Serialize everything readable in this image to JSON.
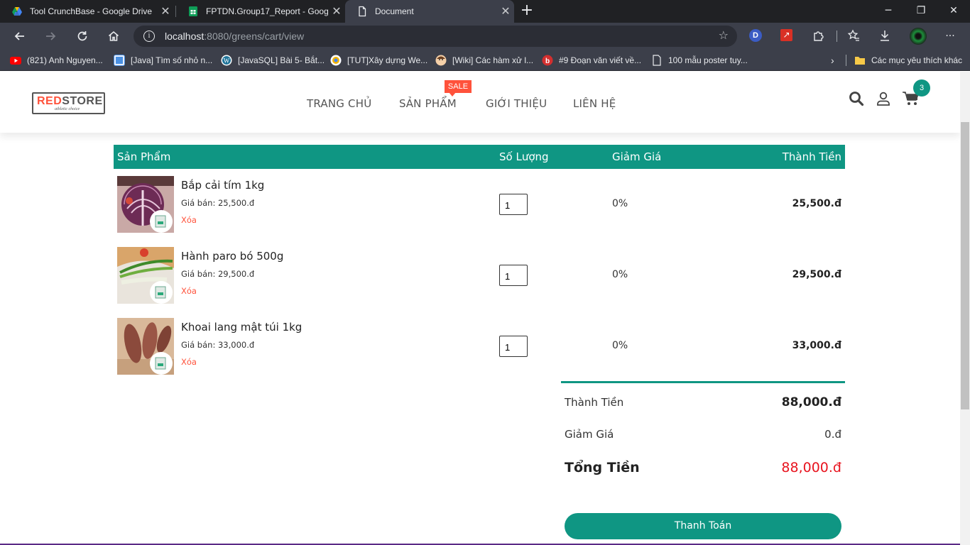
{
  "browser": {
    "tabs": [
      {
        "title": "Tool CrunchBase - Google Drive",
        "icon": "google-drive-icon"
      },
      {
        "title": "FPTDN.Group17_Report - Google",
        "icon": "google-sheets-icon"
      },
      {
        "title": "Document",
        "icon": "document-icon"
      }
    ],
    "url_host": "localhost",
    "url_path": ":8080/greens/cart/view",
    "profile_initial": "D",
    "bookmarks": [
      {
        "label": "(821) Anh Nguyen...",
        "icon": "youtube-icon",
        "color": "#ff0000"
      },
      {
        "label": "[Java] Tìm số nhỏ n...",
        "icon": "site-icon",
        "color": "#4a90e2"
      },
      {
        "label": "[JavaSQL] Bài 5- Bắt...",
        "icon": "wordpress-icon",
        "color": "#21759b"
      },
      {
        "label": "[TUT]Xây dựng We...",
        "icon": "site-icon",
        "color": "#f4b400"
      },
      {
        "label": "[Wiki] Các hàm xử l...",
        "icon": "avatar-icon",
        "color": "#e0a070"
      },
      {
        "label": "#9 Đoạn văn viết về...",
        "icon": "b-icon",
        "color": "#d32f2f"
      },
      {
        "label": "100 mẫu poster tuy...",
        "icon": "page-icon",
        "color": "#e8eaed"
      }
    ],
    "other_bookmarks": "Các mục yêu thích khác"
  },
  "site": {
    "logo_red": "RED",
    "logo_rest": "STORE",
    "logo_slogan": "athletic choice",
    "nav": [
      "TRANG CHỦ",
      "SẢN PHẨM",
      "GIỚI THIỆU",
      "LIÊN HỆ"
    ],
    "sale_badge": "SALE",
    "cart_count": "3"
  },
  "cart": {
    "headers": {
      "product": "Sản Phẩm",
      "quantity": "Số Lượng",
      "discount": "Giảm Giá",
      "total": "Thành Tiền"
    },
    "items": [
      {
        "name": "Bắp cải tím 1kg",
        "price": "Giá bán: 25,500.đ",
        "remove": "Xóa",
        "qty": "1",
        "discount": "0%",
        "total": "25,500.đ",
        "image": "purple-cabbage"
      },
      {
        "name": "Hành paro bó 500g",
        "price": "Giá bán: 29,500.đ",
        "remove": "Xóa",
        "qty": "1",
        "discount": "0%",
        "total": "29,500.đ",
        "image": "leek"
      },
      {
        "name": "Khoai lang mật túi 1kg",
        "price": "Giá bán: 33,000.đ",
        "remove": "Xóa",
        "qty": "1",
        "discount": "0%",
        "total": "33,000.đ",
        "image": "sweet-potato"
      }
    ],
    "summary": {
      "subtotal_label": "Thành Tiền",
      "subtotal": "88,000.đ",
      "discount_label": "Giảm Giá",
      "discount": "0.đ",
      "grand_label": "Tổng Tiền",
      "grand": "88,000.đ"
    },
    "checkout_label": "Thanh Toán"
  },
  "colors": {
    "accent": "#0f9683",
    "brand_red": "#ff523b",
    "grand_total": "#e8141f"
  }
}
